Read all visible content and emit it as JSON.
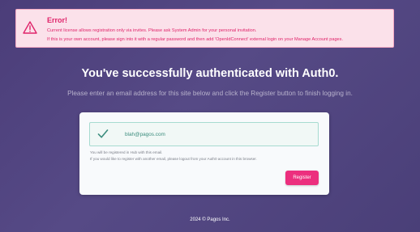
{
  "error": {
    "title": "Error!",
    "line1": "Current license allows registration only via invites. Please ask System Admin for your personal invitation.",
    "line2": "If this is your own account, please sign into it with a regular password and then add 'OpenIdConnect' external login on your Manage Account pages.",
    "icon": "warning-triangle-icon",
    "color": "#e0246a",
    "background": "#fbe1ea"
  },
  "headline": "You've successfully authenticated with Auth0.",
  "subline": "Please enter an email address for this site below and click the Register button to finish logging in.",
  "form": {
    "email_value": "blah@pagos.com",
    "email_icon": "check-icon",
    "note1": "You will be registered in Hub with this email.",
    "note2": "If you would like to register with another email, please logout from your Auth0 account in this browser.",
    "register_label": "Register",
    "accent": "#ec2f7e"
  },
  "footer": "2024 © Pagos Inc."
}
